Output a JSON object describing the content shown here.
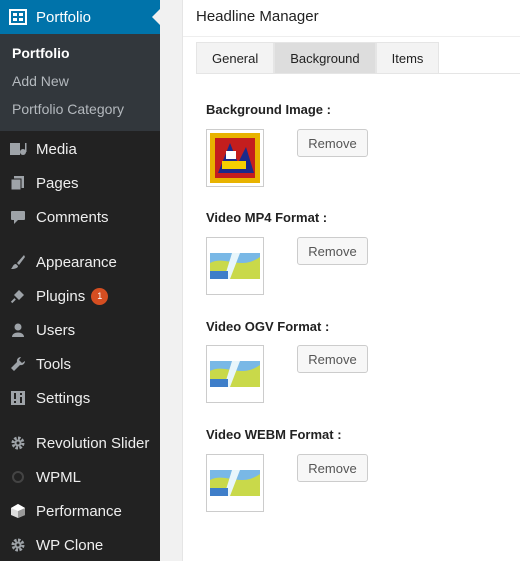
{
  "sidebar": {
    "current_menu": {
      "label": "Portfolio",
      "icon": "portfolio-icon"
    },
    "submenu": [
      {
        "label": "Portfolio",
        "current": true
      },
      {
        "label": "Add New",
        "current": false
      },
      {
        "label": "Portfolio Category",
        "current": false
      }
    ],
    "items": [
      {
        "label": "Media",
        "icon": "media-icon"
      },
      {
        "label": "Pages",
        "icon": "pages-icon"
      },
      {
        "label": "Comments",
        "icon": "comments-icon"
      },
      {
        "label": "Appearance",
        "icon": "brush-icon"
      },
      {
        "label": "Plugins",
        "icon": "plugin-icon",
        "badge": "1"
      },
      {
        "label": "Users",
        "icon": "users-icon"
      },
      {
        "label": "Tools",
        "icon": "wrench-icon"
      },
      {
        "label": "Settings",
        "icon": "settings-icon"
      },
      {
        "label": "Revolution Slider",
        "icon": "gear-icon"
      },
      {
        "label": "WPML",
        "icon": "wpml-icon"
      },
      {
        "label": "Performance",
        "icon": "cube-icon"
      },
      {
        "label": "WP Clone",
        "icon": "gear-icon"
      }
    ]
  },
  "main": {
    "title": "Headline Manager",
    "tabs": [
      {
        "label": "General",
        "active": false
      },
      {
        "label": "Background",
        "active": true
      },
      {
        "label": "Items",
        "active": false
      }
    ],
    "fields": [
      {
        "label": "Background Image :",
        "button": "Remove"
      },
      {
        "label": "Video MP4 Format :",
        "button": "Remove"
      },
      {
        "label": "Video OGV Format :",
        "button": "Remove"
      },
      {
        "label": "Video WEBM Format :",
        "button": "Remove"
      }
    ]
  },
  "colors": {
    "sidebar": "#222222",
    "accent": "#0073aa",
    "badge": "#d54e21"
  }
}
